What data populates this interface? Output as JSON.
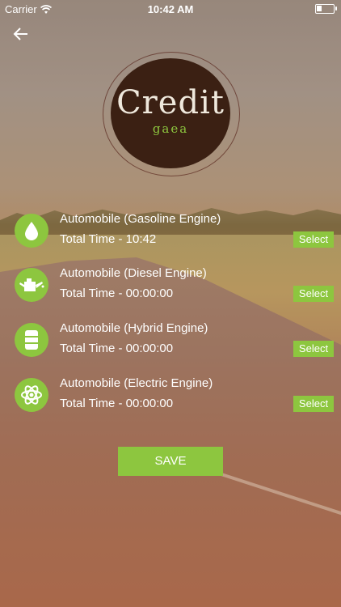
{
  "status_bar": {
    "carrier": "Carrier",
    "time": "10:42 AM"
  },
  "logo": {
    "text": "Credit",
    "subtext": "gaea"
  },
  "engines": [
    {
      "title": "Automobile (Gasoline Engine)",
      "time": "Total Time - 10:42",
      "select_label": "Select",
      "icon": "drop-icon"
    },
    {
      "title": "Automobile (Diesel Engine)",
      "time": "Total Time - 00:00:00",
      "select_label": "Select",
      "icon": "oil-can-icon"
    },
    {
      "title": "Automobile (Hybrid Engine)",
      "time": "Total Time - 00:00:00",
      "select_label": "Select",
      "icon": "barrel-icon"
    },
    {
      "title": "Automobile (Electric Engine)",
      "time": "Total Time - 00:00:00",
      "select_label": "Select",
      "icon": "atom-icon"
    }
  ],
  "save_label": "SAVE",
  "colors": {
    "accent": "#8dc63f",
    "logo_bg": "#3b2013"
  }
}
